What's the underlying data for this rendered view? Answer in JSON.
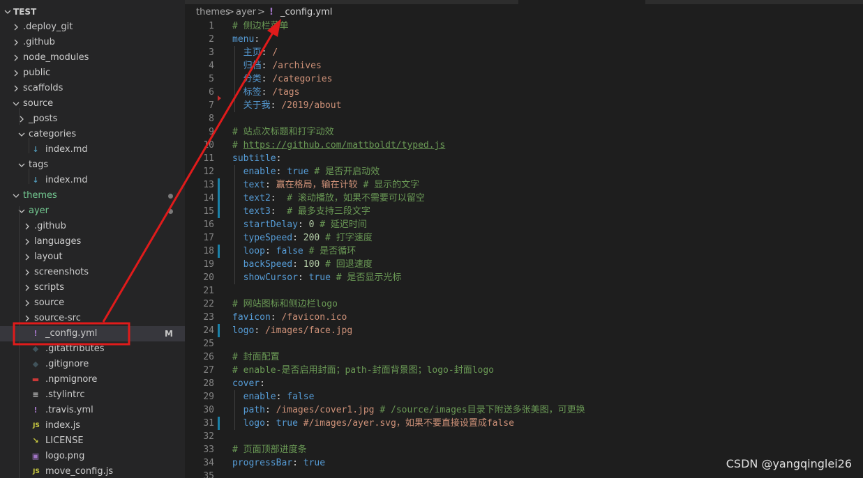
{
  "explorer": {
    "root_label": "TEST",
    "items": [
      {
        "label": ".deploy_git"
      },
      {
        "label": ".github"
      },
      {
        "label": "node_modules"
      },
      {
        "label": "public"
      },
      {
        "label": "scaffolds"
      },
      {
        "label": "source"
      },
      {
        "label": "_posts"
      },
      {
        "label": "categories"
      },
      {
        "label": "index.md"
      },
      {
        "label": "tags"
      },
      {
        "label": "index.md"
      },
      {
        "label": "themes"
      },
      {
        "label": "ayer"
      },
      {
        "label": ".github"
      },
      {
        "label": "languages"
      },
      {
        "label": "layout"
      },
      {
        "label": "screenshots"
      },
      {
        "label": "scripts"
      },
      {
        "label": "source"
      },
      {
        "label": "source-src"
      },
      {
        "label": "_config.yml",
        "badge": "M"
      },
      {
        "label": ".gitattributes"
      },
      {
        "label": ".gitignore"
      },
      {
        "label": ".npmignore"
      },
      {
        "label": ".stylintrc"
      },
      {
        "label": ".travis.yml"
      },
      {
        "label": "index.js"
      },
      {
        "label": "LICENSE"
      },
      {
        "label": "logo.png"
      },
      {
        "label": "move_config.js"
      }
    ]
  },
  "breadcrumb": {
    "segments": [
      "themes",
      "ayer",
      "_config.yml"
    ],
    "separator": ">",
    "file_icon": "!"
  },
  "editor": {
    "lines": [
      {
        "n": "1",
        "t": [
          [
            "cmt",
            "# 侧边栏菜单"
          ]
        ]
      },
      {
        "n": "2",
        "t": [
          [
            "key",
            "menu"
          ],
          [
            "pun",
            ":"
          ]
        ]
      },
      {
        "n": "3",
        "t": [
          [
            "",
            "  "
          ],
          [
            "key",
            "主页"
          ],
          [
            "pun",
            ": "
          ],
          [
            "str",
            "/"
          ]
        ]
      },
      {
        "n": "4",
        "t": [
          [
            "",
            "  "
          ],
          [
            "key",
            "归档"
          ],
          [
            "pun",
            ": "
          ],
          [
            "str",
            "/archives"
          ]
        ]
      },
      {
        "n": "5",
        "t": [
          [
            "",
            "  "
          ],
          [
            "key",
            "分类"
          ],
          [
            "pun",
            ": "
          ],
          [
            "str",
            "/categories"
          ]
        ]
      },
      {
        "n": "6",
        "t": [
          [
            "",
            "  "
          ],
          [
            "key",
            "标签"
          ],
          [
            "pun",
            ": "
          ],
          [
            "str",
            "/tags"
          ]
        ]
      },
      {
        "n": "7",
        "t": [
          [
            "",
            "  "
          ],
          [
            "key",
            "关于我"
          ],
          [
            "pun",
            ": "
          ],
          [
            "str",
            "/2019/about"
          ]
        ]
      },
      {
        "n": "8",
        "t": []
      },
      {
        "n": "9",
        "t": [
          [
            "cmt",
            "# 站点次标题和打字动效"
          ]
        ]
      },
      {
        "n": "10",
        "t": [
          [
            "cmt",
            "# "
          ],
          [
            "link",
            "https://github.com/mattboldt/typed.js"
          ]
        ]
      },
      {
        "n": "11",
        "t": [
          [
            "key",
            "subtitle"
          ],
          [
            "pun",
            ":"
          ]
        ]
      },
      {
        "n": "12",
        "t": [
          [
            "",
            "  "
          ],
          [
            "key",
            "enable"
          ],
          [
            "pun",
            ": "
          ],
          [
            "bool",
            "true"
          ],
          [
            "cmt",
            " # 是否开启动效"
          ]
        ]
      },
      {
        "n": "13",
        "t": [
          [
            "",
            "  "
          ],
          [
            "key",
            "text"
          ],
          [
            "pun",
            ": "
          ],
          [
            "str",
            "赢在格局，输在计较"
          ],
          [
            "cmt",
            " # 显示的文字"
          ]
        ]
      },
      {
        "n": "14",
        "t": [
          [
            "",
            "  "
          ],
          [
            "key",
            "text2"
          ],
          [
            "pun",
            ":  "
          ],
          [
            "cmt",
            "# 滚动播放，如果不需要可以留空"
          ]
        ]
      },
      {
        "n": "15",
        "t": [
          [
            "",
            "  "
          ],
          [
            "key",
            "text3"
          ],
          [
            "pun",
            ":  "
          ],
          [
            "cmt",
            "# 最多支持三段文字"
          ]
        ]
      },
      {
        "n": "16",
        "t": [
          [
            "",
            "  "
          ],
          [
            "key",
            "startDelay"
          ],
          [
            "pun",
            ": "
          ],
          [
            "num",
            "0"
          ],
          [
            "cmt",
            " # 延迟时间"
          ]
        ]
      },
      {
        "n": "17",
        "t": [
          [
            "",
            "  "
          ],
          [
            "key",
            "typeSpeed"
          ],
          [
            "pun",
            ": "
          ],
          [
            "num",
            "200"
          ],
          [
            "cmt",
            " # 打字速度"
          ]
        ]
      },
      {
        "n": "18",
        "t": [
          [
            "",
            "  "
          ],
          [
            "key",
            "loop"
          ],
          [
            "pun",
            ": "
          ],
          [
            "bool",
            "false"
          ],
          [
            "cmt",
            " # 是否循环"
          ]
        ]
      },
      {
        "n": "19",
        "t": [
          [
            "",
            "  "
          ],
          [
            "key",
            "backSpeed"
          ],
          [
            "pun",
            ": "
          ],
          [
            "num",
            "100"
          ],
          [
            "cmt",
            " # 回退速度"
          ]
        ]
      },
      {
        "n": "20",
        "t": [
          [
            "",
            "  "
          ],
          [
            "key",
            "showCursor"
          ],
          [
            "pun",
            ": "
          ],
          [
            "bool",
            "true"
          ],
          [
            "cmt",
            " # 是否显示光标"
          ]
        ]
      },
      {
        "n": "21",
        "t": []
      },
      {
        "n": "22",
        "t": [
          [
            "cmt",
            "# 网站图标和侧边栏logo"
          ]
        ]
      },
      {
        "n": "23",
        "t": [
          [
            "key",
            "favicon"
          ],
          [
            "pun",
            ": "
          ],
          [
            "str",
            "/favicon.ico"
          ]
        ]
      },
      {
        "n": "24",
        "t": [
          [
            "key",
            "logo"
          ],
          [
            "pun",
            ": "
          ],
          [
            "str",
            "/images/face.jpg"
          ]
        ]
      },
      {
        "n": "25",
        "t": []
      },
      {
        "n": "26",
        "t": [
          [
            "cmt",
            "# 封面配置"
          ]
        ]
      },
      {
        "n": "27",
        "t": [
          [
            "cmt",
            "# enable-是否启用封面；path-封面背景图；logo-封面logo"
          ]
        ]
      },
      {
        "n": "28",
        "t": [
          [
            "key",
            "cover"
          ],
          [
            "pun",
            ":"
          ]
        ]
      },
      {
        "n": "29",
        "t": [
          [
            "",
            "  "
          ],
          [
            "key",
            "enable"
          ],
          [
            "pun",
            ": "
          ],
          [
            "bool",
            "false"
          ]
        ]
      },
      {
        "n": "30",
        "t": [
          [
            "",
            "  "
          ],
          [
            "key",
            "path"
          ],
          [
            "pun",
            ": "
          ],
          [
            "str",
            "/images/cover1.jpg"
          ],
          [
            "cmt",
            " # /source/images目录下附送多张美图，可更换"
          ]
        ]
      },
      {
        "n": "31",
        "t": [
          [
            "",
            "  "
          ],
          [
            "key",
            "logo"
          ],
          [
            "pun",
            ": "
          ],
          [
            "bool",
            "true"
          ],
          [
            "str",
            " #/images/ayer.svg，如果不要直接设置成false"
          ]
        ]
      },
      {
        "n": "32",
        "t": []
      },
      {
        "n": "33",
        "t": [
          [
            "cmt",
            "# 页面顶部进度条"
          ]
        ]
      },
      {
        "n": "34",
        "t": [
          [
            "key",
            "progressBar"
          ],
          [
            "pun",
            ": "
          ],
          [
            "bool",
            "true"
          ]
        ]
      },
      {
        "n": "35",
        "t": []
      }
    ]
  },
  "watermark": "CSDN @yangqinglei26",
  "colors": {
    "highlight_box": "#e01b1b",
    "arrow": "#e01b1b",
    "modified_gutter": "#1b81a8"
  }
}
